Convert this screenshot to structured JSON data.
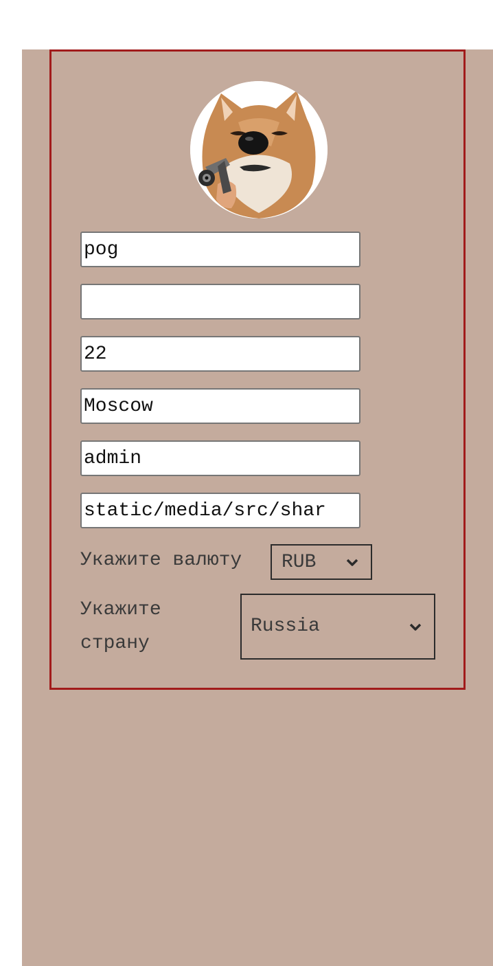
{
  "form": {
    "fields": [
      {
        "name": "first-name-field",
        "value": "pog"
      },
      {
        "name": "last-name-field",
        "value": ""
      },
      {
        "name": "age-field",
        "value": "22"
      },
      {
        "name": "city-field",
        "value": "Moscow"
      },
      {
        "name": "role-field",
        "value": "admin"
      },
      {
        "name": "avatar-path-field",
        "value": "static/media/src/shar"
      }
    ],
    "currency": {
      "label": "Укажите валюту",
      "selected": "RUB"
    },
    "country": {
      "label_line1": "Укажите",
      "label_line2": "страну",
      "selected": "Russia"
    }
  },
  "colors": {
    "background": "#c4ab9d",
    "card_border": "#a11b1b"
  },
  "icons": {
    "select_arrow": "chevron-down-icon"
  }
}
